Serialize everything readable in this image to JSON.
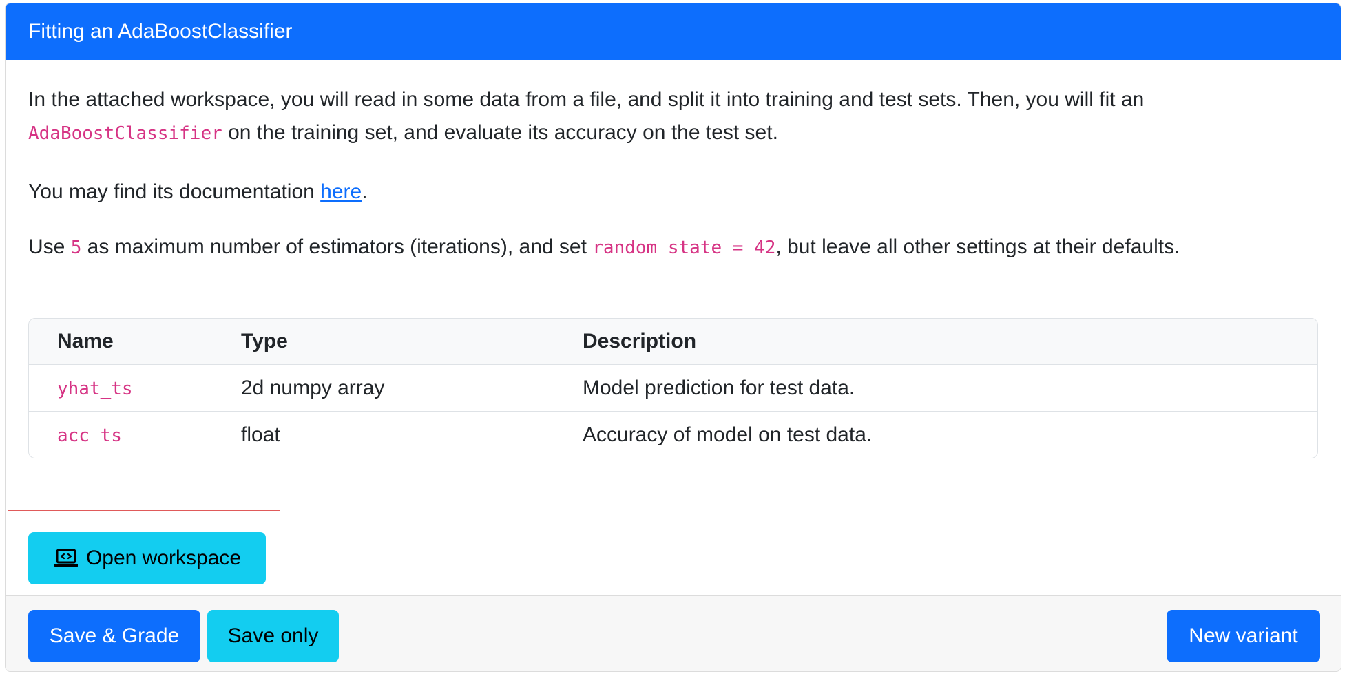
{
  "header": {
    "title": "Fitting an AdaBoostClassifier"
  },
  "intro": {
    "text1": "In the attached workspace, you will read in some data from a file, and split it into training and test sets. Then, you will fit an ",
    "code1": "AdaBoostClassifier",
    "text2": " on the training set, and evaluate its accuracy on the test set."
  },
  "doc": {
    "text1": "You may find its documentation ",
    "link": "here",
    "text2": "."
  },
  "settings": {
    "text1": "Use ",
    "code1": "5",
    "text2": " as maximum number of estimators (iterations), and set ",
    "code2": "random_state = 42",
    "text3": ", but leave all other settings at their defaults."
  },
  "table": {
    "headers": [
      "Name",
      "Type",
      "Description"
    ],
    "rows": [
      {
        "name": "yhat_ts",
        "type": "2d numpy array",
        "description": "Model prediction for test data."
      },
      {
        "name": "acc_ts",
        "type": "float",
        "description": "Accuracy of model on test data."
      }
    ]
  },
  "workspace_button": {
    "label": "Open workspace",
    "icon": "laptop-code-icon"
  },
  "footer": {
    "save_grade": "Save & Grade",
    "save_only": "Save only",
    "new_variant": "New variant"
  },
  "colors": {
    "primary": "#0d6efd",
    "info": "#13cdf0",
    "code": "#d63384"
  }
}
